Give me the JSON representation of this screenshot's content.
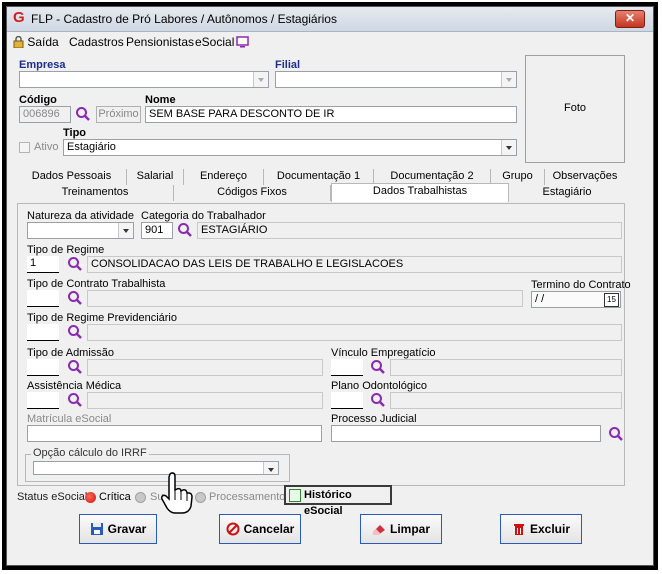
{
  "window": {
    "title": "FLP - Cadastro de Pró Labores / Autônomos / Estagiários",
    "close_glyph": "✕"
  },
  "menu": [
    {
      "label": "Saída"
    },
    {
      "label": "Cadastros"
    },
    {
      "label": "Pensionistas"
    },
    {
      "label": "eSocial"
    }
  ],
  "header": {
    "empresa_label": "Empresa",
    "empresa_value": "",
    "filial_label": "Filial",
    "filial_value": "",
    "codigo_label": "Código",
    "codigo_value": "006896",
    "proximo_label": "Próximo",
    "nome_label": "Nome",
    "nome_value": "SEM BASE PARA DESCONTO DE IR",
    "tipo_label": "Tipo",
    "tipo_value": "Estagiário",
    "ativo_label": "Ativo",
    "foto_label": "Foto"
  },
  "tabs_row1": [
    "Dados Pessoais",
    "Salarial",
    "Endereço",
    "Documentação 1",
    "Documentação 2",
    "Grupo",
    "Observações"
  ],
  "tabs_row2": [
    "Treinamentos",
    "Códigos Fixos",
    "Dados Trabalhistas",
    "Estagiário"
  ],
  "active_tab": "Dados Trabalhistas",
  "trab": {
    "natureza_label": "Natureza da atividade",
    "natureza_value": "",
    "categoria_label": "Categoria do Trabalhador",
    "categoria_code": "901",
    "categoria_desc": "ESTAGIÁRIO",
    "regime_label": "Tipo de Regime",
    "regime_code": "1",
    "regime_desc": "CONSOLIDACAO DAS LEIS DE TRABALHO E LEGISLACOES",
    "contrato_label": "Tipo de Contrato Trabalhista",
    "contrato_code": "",
    "contrato_desc": "",
    "termino_label": "Termino do Contrato",
    "termino_value": " /  /",
    "calendar_glyph": "15",
    "previd_label": "Tipo de Regime Previdenciário",
    "admissao_label": "Tipo de Admissão",
    "vinculo_label": "Vínculo Empregatício",
    "assist_label": "Assistência Médica",
    "plano_label": "Plano Odontológico",
    "matricula_label": "Matrícula eSocial",
    "processo_label": "Processo Judicial",
    "irrf_label": "Opção cálculo do IRRF"
  },
  "status": {
    "label": "Status eSocial:",
    "critica": "Crítica",
    "sucesso": "Su",
    "processamento": "Processamento",
    "historico": "Histórico eSocial"
  },
  "buttons": {
    "gravar": "Gravar",
    "cancelar": "Cancelar",
    "limpar": "Limpar",
    "excluir": "Excluir"
  },
  "colors": {
    "accent": "#1d2e8c",
    "critica": "#e02020",
    "magnifier": "#7a2ab0"
  }
}
